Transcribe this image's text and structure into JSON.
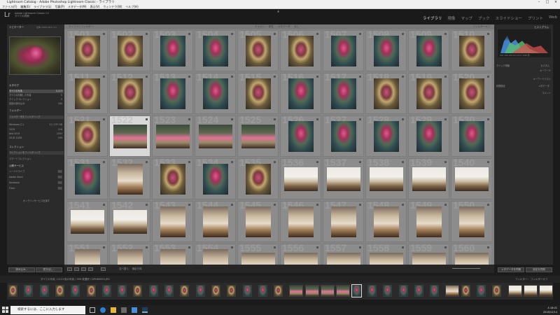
{
  "window": {
    "title": "Lightroom Catalog - Adobe Photoshop Lightroom Classic - ライブラリ"
  },
  "menu": [
    "ファイル(F)",
    "編集(E)",
    "ライブラリ(L)",
    "写真(P)",
    "メタデータ(M)",
    "表示(V)",
    "ウィンドウ(W)",
    "ヘルプ(H)"
  ],
  "identity": {
    "logo": "Lr",
    "catalog_line1": "Adobe Lightroom Classic CC",
    "catalog_line2": "すべての同期"
  },
  "modules": [
    "ライブラリ",
    "現像",
    "マップ",
    "ブック",
    "スライドショー",
    "プリント",
    "Web"
  ],
  "left_panel": {
    "navigator_label": "ナビゲーター",
    "navigator_zoom": [
      "全体",
      "100%",
      "50%",
      "1:1"
    ],
    "catalog_label": "カタログ",
    "catalog_items": [
      {
        "label": "すべての写真",
        "count": "2,113"
      },
      {
        "label": "すべての同期した写真",
        "count": "0"
      },
      {
        "label": "クイックコレクション",
        "count": "0"
      },
      {
        "label": "前回の読み込み",
        "count": "180"
      }
    ],
    "folders_label": "フォルダー",
    "folder_search": "フォルダー内をフィルタリング",
    "volume": {
      "label": "Windows (C:)",
      "info": "11 / 237 GB"
    },
    "folders": [
      {
        "label": "2019",
        "count": "116"
      },
      {
        "label": "test 2019",
        "count": "1593"
      },
      {
        "label": "2018 11/08",
        "count": "199"
      }
    ],
    "collections_label": "コレクション",
    "collection_search": "コレクションをフィルタリング",
    "collections": [
      {
        "label": "スマートコレクション"
      }
    ],
    "publish_label": "公開サービス",
    "publish_items": [
      {
        "label": "ハードドライブ",
        "count": "設定"
      },
      {
        "label": "Adobe Stock",
        "count": "設定"
      },
      {
        "label": "Facebook",
        "count": "設定"
      },
      {
        "label": "Flickr",
        "count": "設定"
      }
    ],
    "publish_more": "オンラインサービスを探す",
    "import_button": "読み込み...",
    "export_button": "書き出し..."
  },
  "grid": {
    "filter_bar_label": "ライブラリフィルター：",
    "filter_tabs": [
      "テキスト",
      "属性",
      "メタデータ",
      "なし"
    ],
    "filter_preset": "フィルターオフ",
    "start_number": 1501,
    "rows": [
      [
        "p2",
        "p2",
        "p1",
        "p1",
        "p2",
        "p2",
        "p1",
        "p1",
        "p1",
        "p2"
      ],
      [
        "p2",
        "p2",
        "p1",
        "p1",
        "p2",
        "p1",
        "p1",
        "p2",
        "p2",
        "p2"
      ],
      [
        "p2",
        "p6",
        "p6",
        "p6",
        "p6",
        "p1",
        "p1",
        "p1",
        "p1",
        "p1"
      ],
      [
        "p1",
        "p5",
        "p2",
        "p1",
        "p2",
        "p4",
        "p4",
        "p4",
        "p4",
        "p4"
      ],
      [
        "p4",
        "p4",
        "p5",
        "p5",
        "p5",
        "p5",
        "p5",
        "p5",
        "p5",
        "p5"
      ],
      [
        "p5",
        "p5",
        "p5",
        "p5",
        "p5",
        "p5",
        "p5",
        "p5",
        "p5",
        "p5"
      ]
    ],
    "landscape": [
      [
        false,
        false,
        false,
        false,
        false,
        false,
        false,
        false,
        false,
        false
      ],
      [
        false,
        false,
        false,
        false,
        false,
        false,
        false,
        false,
        false,
        false
      ],
      [
        false,
        true,
        true,
        true,
        true,
        false,
        false,
        false,
        false,
        false
      ],
      [
        false,
        false,
        false,
        false,
        false,
        true,
        true,
        true,
        true,
        true
      ],
      [
        true,
        true,
        false,
        false,
        false,
        false,
        false,
        false,
        false,
        false
      ],
      [
        false,
        false,
        false,
        false,
        true,
        true,
        true,
        true,
        true,
        true
      ]
    ],
    "selected_index": 21
  },
  "toolbar": {
    "sort_label": "並べ替え：",
    "sort_value": "撮影日時",
    "sync_metadata": "メタデータを同期",
    "sync_settings": "設定を同期"
  },
  "right_panel": {
    "histogram_label": "ヒストグラム",
    "histogram_info": "ISO 100   28 mm   f/4.0   1/60 秒",
    "original_photo": "元の写真",
    "quick_develop_label": "クイック現像",
    "quick_develop_preset": "カスタム",
    "keywords_label": "キーワード",
    "keyword_list_label": "キーワードリスト",
    "metadata_label": "メタデータ",
    "metadata_preset": "初期設定",
    "comments_label": "コメント"
  },
  "filmstrip": {
    "breadcrumb": "すべての写真 / 2113 枚の写真 / 999 枚選択 / DPH89059.JPG",
    "filter_label": "フィルター：",
    "filter_value": "フィルターオフ",
    "thumbs": [
      "p2",
      "p1",
      "p1",
      "p2",
      "p1",
      "p2",
      "p1",
      "p1",
      "p2",
      "p1",
      "p1",
      "p2",
      "p1",
      "p2",
      "p2",
      "p1",
      "p1",
      "p2",
      "p6",
      "p6",
      "p6",
      "p6",
      "p1",
      "p1",
      "p1",
      "p1",
      "p1",
      "p1",
      "p5",
      "p2",
      "p1",
      "p2",
      "p4",
      "p4",
      "p4"
    ]
  },
  "taskbar": {
    "search_placeholder": "検索するには、ここに入力します",
    "time": "18:01",
    "date": "2018/12/14",
    "ime": "A"
  }
}
